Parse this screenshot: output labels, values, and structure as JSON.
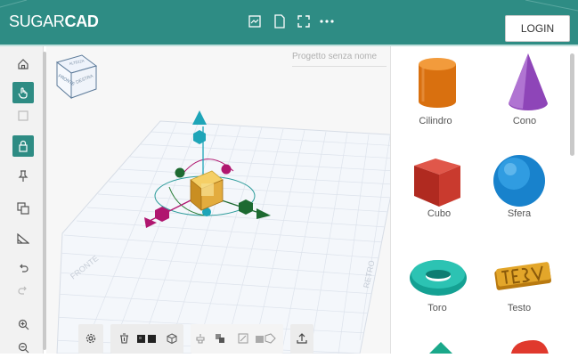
{
  "header": {
    "logo_light": "SUGAR",
    "logo_bold": "CAD",
    "login_label": "LOGIN"
  },
  "viewport": {
    "project_name_placeholder": "Progetto senza nome",
    "view_cube": {
      "top": "ALTEZZA",
      "front": "FRONTE",
      "right": "DESTRA"
    },
    "grid_labels": {
      "front": "FRONTE",
      "right": "RETRO"
    }
  },
  "shapes": [
    {
      "label": "Cilindro",
      "icon": "cylinder-icon",
      "color": "#e07a12"
    },
    {
      "label": "Cono",
      "icon": "cone-icon",
      "color": "#9b4fc2"
    },
    {
      "label": "Cubo",
      "icon": "cube-icon",
      "color": "#c0342b"
    },
    {
      "label": "Sfera",
      "icon": "sphere-icon",
      "color": "#1a8fd6"
    },
    {
      "label": "Toro",
      "icon": "torus-icon",
      "color": "#1fb3a5"
    },
    {
      "label": "Testo",
      "icon": "text-3d-icon",
      "color": "#d99a1a"
    }
  ],
  "colors": {
    "brand": "#2e8c84",
    "gizmo_cyan": "#1ea5b8",
    "gizmo_magenta": "#b0166f",
    "gizmo_green": "#1d6a31"
  }
}
